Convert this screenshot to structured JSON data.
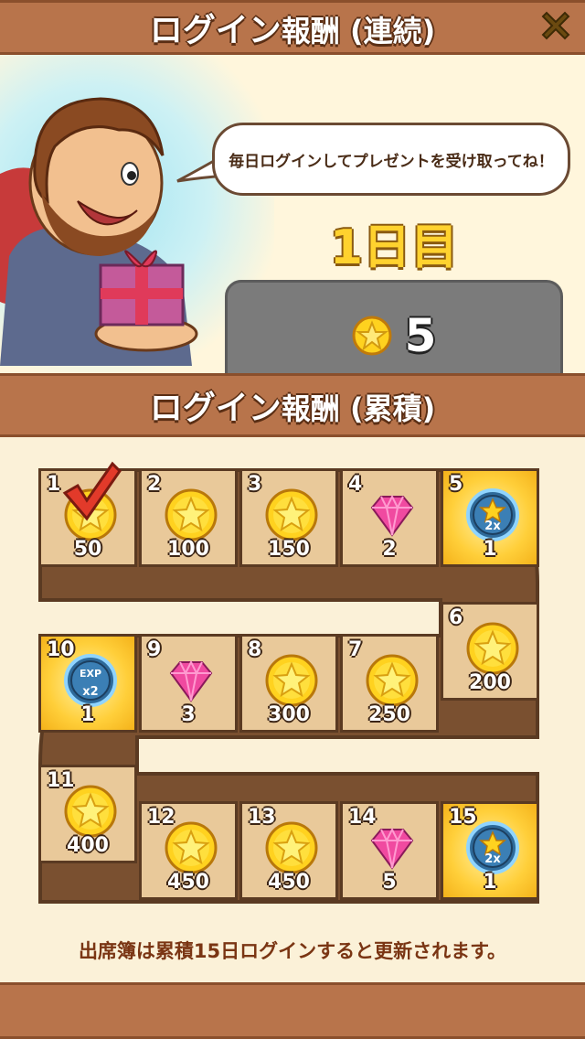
{
  "header": {
    "title_bold": "ログイン",
    "title_rest": "報酬 (連続)"
  },
  "speech_bubble": "毎日ログインしてプレゼントを受け取ってね！",
  "today": {
    "day_label": "1日目",
    "reward_icon": "star-coin-icon",
    "reward_amount": "5"
  },
  "cumulative": {
    "title_bold": "ログイン",
    "title_rest": "報酬 (累積)"
  },
  "tiles": [
    {
      "day": "1",
      "reward": "coin",
      "value": "50",
      "claimed": true
    },
    {
      "day": "2",
      "reward": "coin",
      "value": "100",
      "claimed": false
    },
    {
      "day": "3",
      "reward": "coin",
      "value": "150",
      "claimed": false
    },
    {
      "day": "4",
      "reward": "gem",
      "value": "2",
      "claimed": false
    },
    {
      "day": "5",
      "reward": "coin-boost",
      "badge": "2x",
      "value": "1",
      "special": true
    },
    {
      "day": "6",
      "reward": "coin",
      "value": "200"
    },
    {
      "day": "7",
      "reward": "coin",
      "value": "250"
    },
    {
      "day": "8",
      "reward": "coin",
      "value": "300"
    },
    {
      "day": "9",
      "reward": "gem",
      "value": "3"
    },
    {
      "day": "10",
      "reward": "exp-boost",
      "badge_top": "EXP",
      "badge": "x2",
      "value": "1",
      "special": true
    },
    {
      "day": "11",
      "reward": "coin",
      "value": "400"
    },
    {
      "day": "12",
      "reward": "coin",
      "value": "450"
    },
    {
      "day": "13",
      "reward": "coin",
      "value": "450"
    },
    {
      "day": "14",
      "reward": "gem",
      "value": "5"
    },
    {
      "day": "15",
      "reward": "coin-boost",
      "badge": "2x",
      "value": "1",
      "special": true
    }
  ],
  "footer_note": "出席簿は累積15日ログインすると更新されます。",
  "colors": {
    "banner": "#b8744b",
    "tile": "#e9c99a",
    "special_tile": "#ffcf3a",
    "track_border": "#5a3a22",
    "coin": "#ffd21f",
    "gem": "#f04aa0"
  }
}
